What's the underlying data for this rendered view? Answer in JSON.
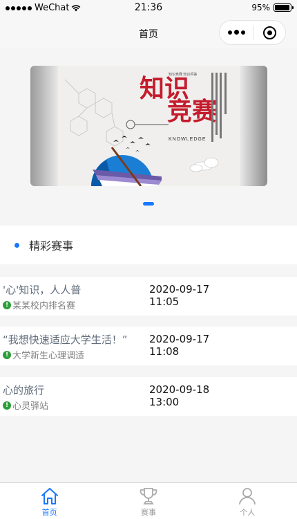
{
  "status_bar": {
    "carrier": "WeChat",
    "time": "21:36",
    "battery_text": "95%",
    "battery_level": 0.95
  },
  "nav": {
    "title": "首页"
  },
  "banner": {
    "text_main_1": "知识",
    "text_main_2": "竞赛",
    "text_en": "KNOWLEDGE",
    "text_small": "知识竞赛 知识问答"
  },
  "section": {
    "title": "精彩赛事"
  },
  "events": [
    {
      "name": "'心'知识，人人普",
      "org": "某某校内排名赛",
      "date": "2020-09-17",
      "time": "11:05"
    },
    {
      "name": "“我想快速适应大学生活！”",
      "org": "大学新生心理调适",
      "date": "2020-09-17",
      "time": "11:08"
    },
    {
      "name": "心的旅行",
      "org": "心灵驿站",
      "date": "2020-09-18",
      "time": "13:00"
    }
  ],
  "tabs": [
    {
      "label": "首页",
      "icon": "home-icon",
      "active": true
    },
    {
      "label": "赛事",
      "icon": "trophy-icon",
      "active": false
    },
    {
      "label": "个人",
      "icon": "user-icon",
      "active": false
    }
  ],
  "colors": {
    "accent": "#1677ff",
    "org_icon": "#2c9e3a"
  }
}
